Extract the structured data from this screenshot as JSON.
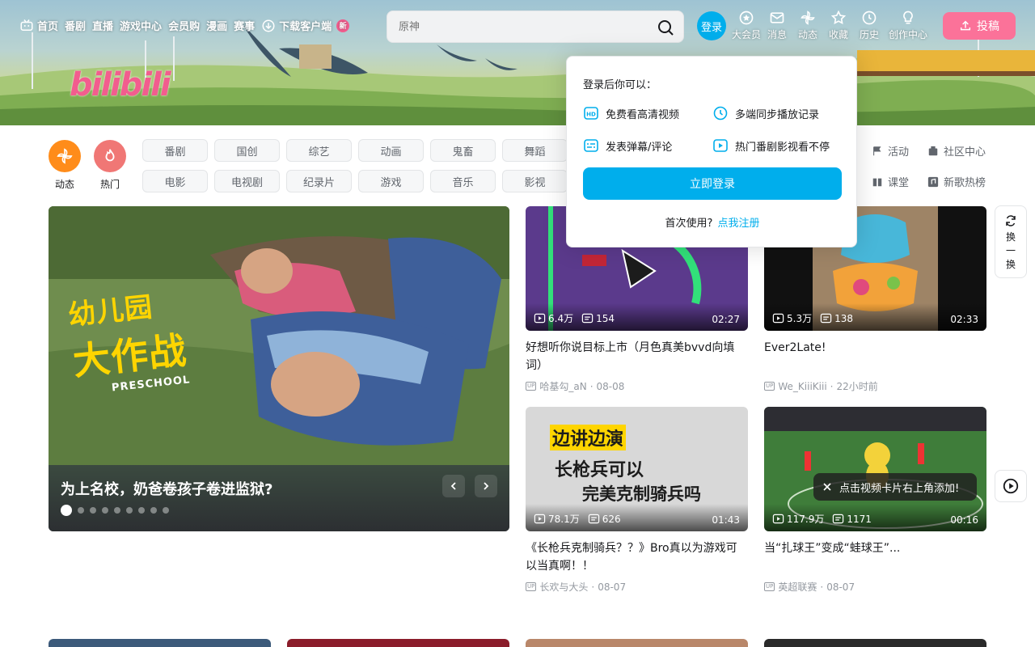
{
  "nav": {
    "items": [
      {
        "label": "首页",
        "icon": "tv-icon"
      },
      {
        "label": "番剧"
      },
      {
        "label": "直播"
      },
      {
        "label": "游戏中心"
      },
      {
        "label": "会员购"
      },
      {
        "label": "漫画"
      },
      {
        "label": "赛事"
      },
      {
        "label": "下载客户端",
        "icon": "download-icon"
      }
    ],
    "new_badge": "新",
    "search_placeholder": "原神",
    "login_avatar": "登录",
    "right": [
      "大会员",
      "消息",
      "动态",
      "收藏",
      "历史",
      "创作中心"
    ],
    "upload": "投稿"
  },
  "logo_text": "bilibili",
  "channels": {
    "circles": [
      {
        "label": "动态",
        "color": "#ff6699"
      },
      {
        "label": "热门",
        "color": "#f07775"
      }
    ],
    "row1": [
      "番剧",
      "国创",
      "综艺",
      "动画",
      "鬼畜",
      "舞蹈"
    ],
    "row2": [
      "电影",
      "电视剧",
      "纪录片",
      "游戏",
      "音乐",
      "影视"
    ],
    "side": [
      "活动",
      "社区中心",
      "课堂",
      "新歌热榜"
    ]
  },
  "hero": {
    "title": "为上名校，奶爸卷孩子卷进监狱?",
    "poster_line1": "幼儿园",
    "poster_line2": "大作战",
    "poster_line3": "PRESCHOOL",
    "slide_count": 9,
    "active_slide": 0
  },
  "cards": [
    {
      "views": "6.4万",
      "danmaku": "154",
      "duration": "02:27",
      "title": "好想听你说目标上市（月色真美bvvd向填词）",
      "author": "哈基勾_aN",
      "date": "08-08"
    },
    {
      "views": "5.3万",
      "danmaku": "138",
      "duration": "02:33",
      "title": "Ever2Late!",
      "author": "We_KiiiKiii",
      "date": "22小时前"
    },
    {
      "views": "78.1万",
      "danmaku": "626",
      "duration": "01:43",
      "title": "《长枪兵克制骑兵？？》Bro真以为游戏可以当真啊！！",
      "author": "长欢与大头",
      "date": "08-07",
      "cap1": "边讲边演",
      "cap2": "长枪兵可以",
      "cap3": "完美克制骑兵吗"
    },
    {
      "views": "117.9万",
      "danmaku": "1171",
      "duration": "00:16",
      "title": "当“扎球王”变成“蛙球王”...",
      "author": "英超联赛",
      "date": "08-07"
    }
  ],
  "up_tag": "UP",
  "popover": {
    "title": "登录后你可以：",
    "benefits": [
      "免费看高清视频",
      "多端同步播放记录",
      "发表弹幕/评论",
      "热门番剧影视看不停"
    ],
    "login_button": "立即登录",
    "first_use": "首次使用?",
    "register": "点我注册"
  },
  "refresh": "换一换",
  "tooltip": "点击视频卡片右上角添加!"
}
